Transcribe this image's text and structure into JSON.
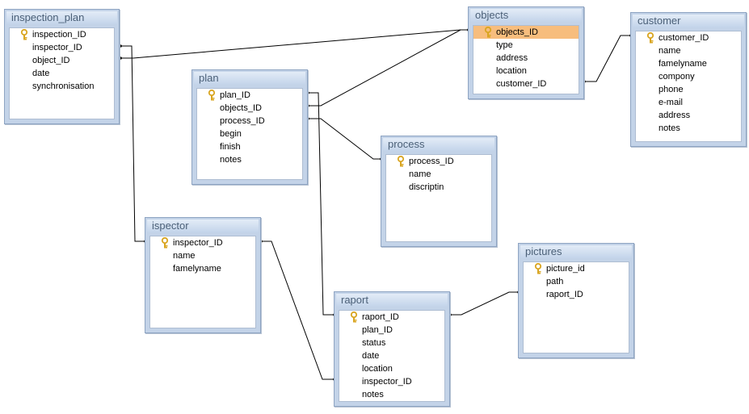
{
  "tables": [
    {
      "id": "inspection_plan",
      "name": "inspection_plan",
      "fields": [
        {
          "name": "inspection_ID",
          "pk": true
        },
        {
          "name": "inspector_ID"
        },
        {
          "name": "object_ID"
        },
        {
          "name": "date"
        },
        {
          "name": "synchronisation"
        }
      ]
    },
    {
      "id": "plan",
      "name": "plan",
      "fields": [
        {
          "name": "plan_ID",
          "pk": true
        },
        {
          "name": "objects_ID"
        },
        {
          "name": "process_ID"
        },
        {
          "name": "begin"
        },
        {
          "name": "finish"
        },
        {
          "name": "notes"
        }
      ]
    },
    {
      "id": "objects",
      "name": "objects",
      "fields": [
        {
          "name": "objects_ID",
          "pk": true,
          "selected": true
        },
        {
          "name": "type"
        },
        {
          "name": "address"
        },
        {
          "name": "location"
        },
        {
          "name": "customer_ID"
        }
      ]
    },
    {
      "id": "customer",
      "name": "customer",
      "fields": [
        {
          "name": "customer_ID",
          "pk": true
        },
        {
          "name": "name"
        },
        {
          "name": "famelyname"
        },
        {
          "name": "compony"
        },
        {
          "name": "phone"
        },
        {
          "name": "e-mail"
        },
        {
          "name": "address"
        },
        {
          "name": "notes"
        }
      ]
    },
    {
      "id": "process",
      "name": "process",
      "fields": [
        {
          "name": "process_ID",
          "pk": true
        },
        {
          "name": "name"
        },
        {
          "name": "discriptin"
        }
      ]
    },
    {
      "id": "ispector",
      "name": "ispector",
      "fields": [
        {
          "name": "inspector_ID",
          "pk": true
        },
        {
          "name": "name"
        },
        {
          "name": "famelyname"
        }
      ]
    },
    {
      "id": "raport",
      "name": "raport",
      "fields": [
        {
          "name": "raport_ID",
          "pk": true
        },
        {
          "name": "plan_ID"
        },
        {
          "name": "status"
        },
        {
          "name": "date"
        },
        {
          "name": "location"
        },
        {
          "name": "inspector_ID"
        },
        {
          "name": "notes"
        }
      ]
    },
    {
      "id": "pictures",
      "name": "pictures",
      "fields": [
        {
          "name": "picture_id",
          "pk": true
        },
        {
          "name": "path"
        },
        {
          "name": "raport_ID"
        }
      ]
    }
  ],
  "relationships": [
    {
      "from": "inspection_plan.object_ID",
      "to": "objects.objects_ID"
    },
    {
      "from": "inspection_plan.inspector_ID",
      "to": "ispector.inspector_ID"
    },
    {
      "from": "plan.objects_ID",
      "to": "objects.objects_ID"
    },
    {
      "from": "plan.process_ID",
      "to": "process.process_ID"
    },
    {
      "from": "plan.plan_ID",
      "to": "raport.plan_ID"
    },
    {
      "from": "objects.customer_ID",
      "to": "customer.customer_ID"
    },
    {
      "from": "ispector.inspector_ID",
      "to": "raport.inspector_ID"
    },
    {
      "from": "raport.raport_ID",
      "to": "pictures.raport_ID"
    }
  ],
  "colors": {
    "table_frame": "#c3d3e8",
    "title_text": "#4b6078",
    "selected_row": "#f7bd7d",
    "key_icon": "#d9a520",
    "relationship_line": "#000000"
  }
}
